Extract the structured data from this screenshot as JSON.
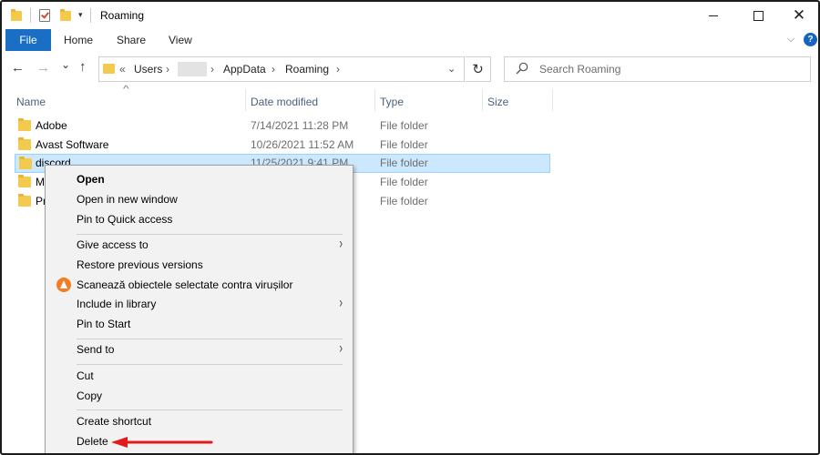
{
  "window": {
    "title": "Roaming",
    "quick_access_arrow": "▾",
    "min_label": "",
    "max_label": "",
    "close_label": "✕"
  },
  "ribbon": {
    "tabs": [
      "File",
      "Home",
      "Share",
      "View"
    ],
    "expand_label": "⌵",
    "help_label": "?"
  },
  "nav": {
    "back": "←",
    "forward": "→",
    "recent": "⌄",
    "up": "↑",
    "refresh": "↻"
  },
  "address": {
    "prefix": "«",
    "crumbs": [
      "Users",
      "",
      "AppData",
      "Roaming"
    ],
    "separator": "›",
    "dropdown": "⌄"
  },
  "search": {
    "placeholder": "Search Roaming"
  },
  "columns": [
    "Name",
    "Date modified",
    "Type",
    "Size"
  ],
  "files": [
    {
      "name": "Adobe",
      "date": "7/14/2021 11:28 PM",
      "type": "File folder"
    },
    {
      "name": "Avast Software",
      "date": "10/26/2021 11:52 AM",
      "type": "File folder"
    },
    {
      "name": "discord",
      "date": "11/25/2021 9:41 PM",
      "type": "File folder"
    },
    {
      "name": "M",
      "date": "",
      "type": "File folder"
    },
    {
      "name": "Pr",
      "date": "",
      "type": "File folder"
    }
  ],
  "selected_row": 2,
  "context_menu": {
    "items": [
      {
        "label": "Open",
        "bold": true
      },
      {
        "label": "Open in new window"
      },
      {
        "label": "Pin to Quick access"
      },
      {
        "label": "Give access to",
        "submenu": true
      },
      {
        "label": "Restore previous versions"
      },
      {
        "label": "Scanează obiectele selectate contra virușilor",
        "icon": "avast-icon"
      },
      {
        "label": "Include in library",
        "submenu": true
      },
      {
        "label": "Pin to Start"
      },
      {
        "label": "Send to",
        "submenu": true
      },
      {
        "label": "Cut"
      },
      {
        "label": "Copy"
      },
      {
        "label": "Create shortcut"
      },
      {
        "label": "Delete"
      }
    ],
    "submenu_arrow": "›"
  },
  "colors": {
    "file_tab": "#1a6ec3",
    "selection": "#cce8ff",
    "folder": "#f3c94e",
    "annotation_arrow": "#e11b1b",
    "avast": "#f37d22"
  }
}
